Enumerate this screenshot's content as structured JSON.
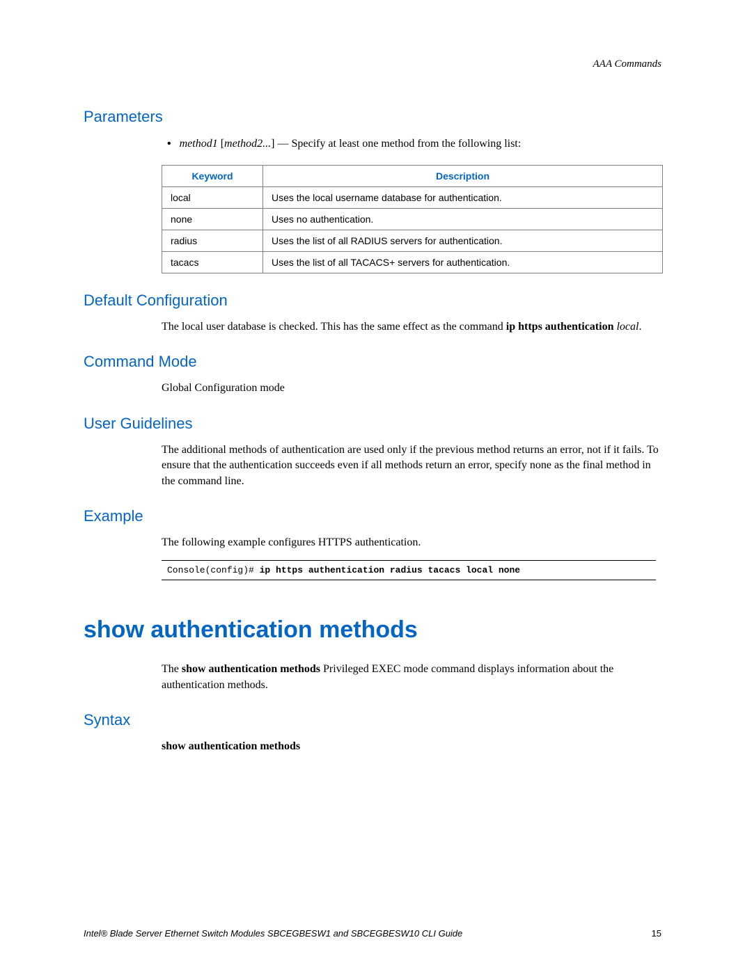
{
  "header": {
    "right": "AAA Commands"
  },
  "parameters": {
    "heading": "Parameters",
    "bullet": {
      "method1": "method1",
      "method2_bracket": "[method2...]",
      "rest": " — Specify at least one method from the following list:"
    },
    "table": {
      "head_keyword": "Keyword",
      "head_description": "Description",
      "rows": [
        {
          "k": "local",
          "d": "Uses the local username database for authentication."
        },
        {
          "k": "none",
          "d": "Uses no authentication."
        },
        {
          "k": "radius",
          "d": "Uses the list of all RADIUS servers for authentication."
        },
        {
          "k": "tacacs",
          "d": "Uses the list of all TACACS+ servers for authentication."
        }
      ]
    }
  },
  "default_config": {
    "heading": "Default Configuration",
    "text_pre": "The local user database is checked. This has the same effect as the command ",
    "text_bold": "ip https authentication",
    "text_italic": " local",
    "text_post": "."
  },
  "command_mode": {
    "heading": "Command Mode",
    "text": "Global Configuration mode"
  },
  "user_guidelines": {
    "heading": "User Guidelines",
    "text": "The additional methods of authentication are used only if the previous method returns an error, not if it fails. To ensure that the authentication succeeds even if all methods return an error, specify none as the final method in the command line."
  },
  "example": {
    "heading": "Example",
    "intro": "The following example configures HTTPS authentication.",
    "code_plain": "Console(config)# ",
    "code_bold": "ip https authentication radius tacacs local none"
  },
  "show_auth": {
    "heading": "show authentication methods",
    "text_pre": "The ",
    "text_bold": "show authentication methods",
    "text_mid": " Privileged EXEC mode command displays information about the authentication methods."
  },
  "syntax": {
    "heading": "Syntax",
    "text_bold": "show authentication methods"
  },
  "footer": {
    "text": "Intel® Blade Server Ethernet Switch Modules SBCEGBESW1 and SBCEGBESW10 CLI Guide",
    "page": "15"
  }
}
